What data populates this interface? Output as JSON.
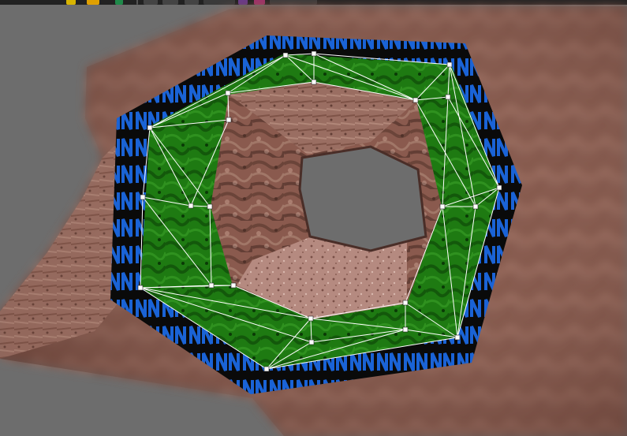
{
  "app": {
    "view": "3d-viewport",
    "top_toolbar": {
      "icons": [
        "toolbar-button-yellow",
        "toolbar-button-orange",
        "toolbar-button-green",
        "toolbar-button-grey",
        "toolbar-button-grey",
        "toolbar-button-purple",
        "toolbar-button-pink",
        "toolbar-button-grey"
      ]
    }
  },
  "scene": {
    "selected_object": "tunnel-ring",
    "wireframe": true,
    "colors": {
      "background": "#6d6d6d",
      "rock": "#8a5a4e",
      "ring_face": "#1e7a12",
      "ring_edge": "#1a63d6",
      "stripe": "#0a0a0a",
      "wire": "#ffffff",
      "vertex_handle": "#ffffff"
    },
    "rim_pattern_glyph": "N"
  }
}
